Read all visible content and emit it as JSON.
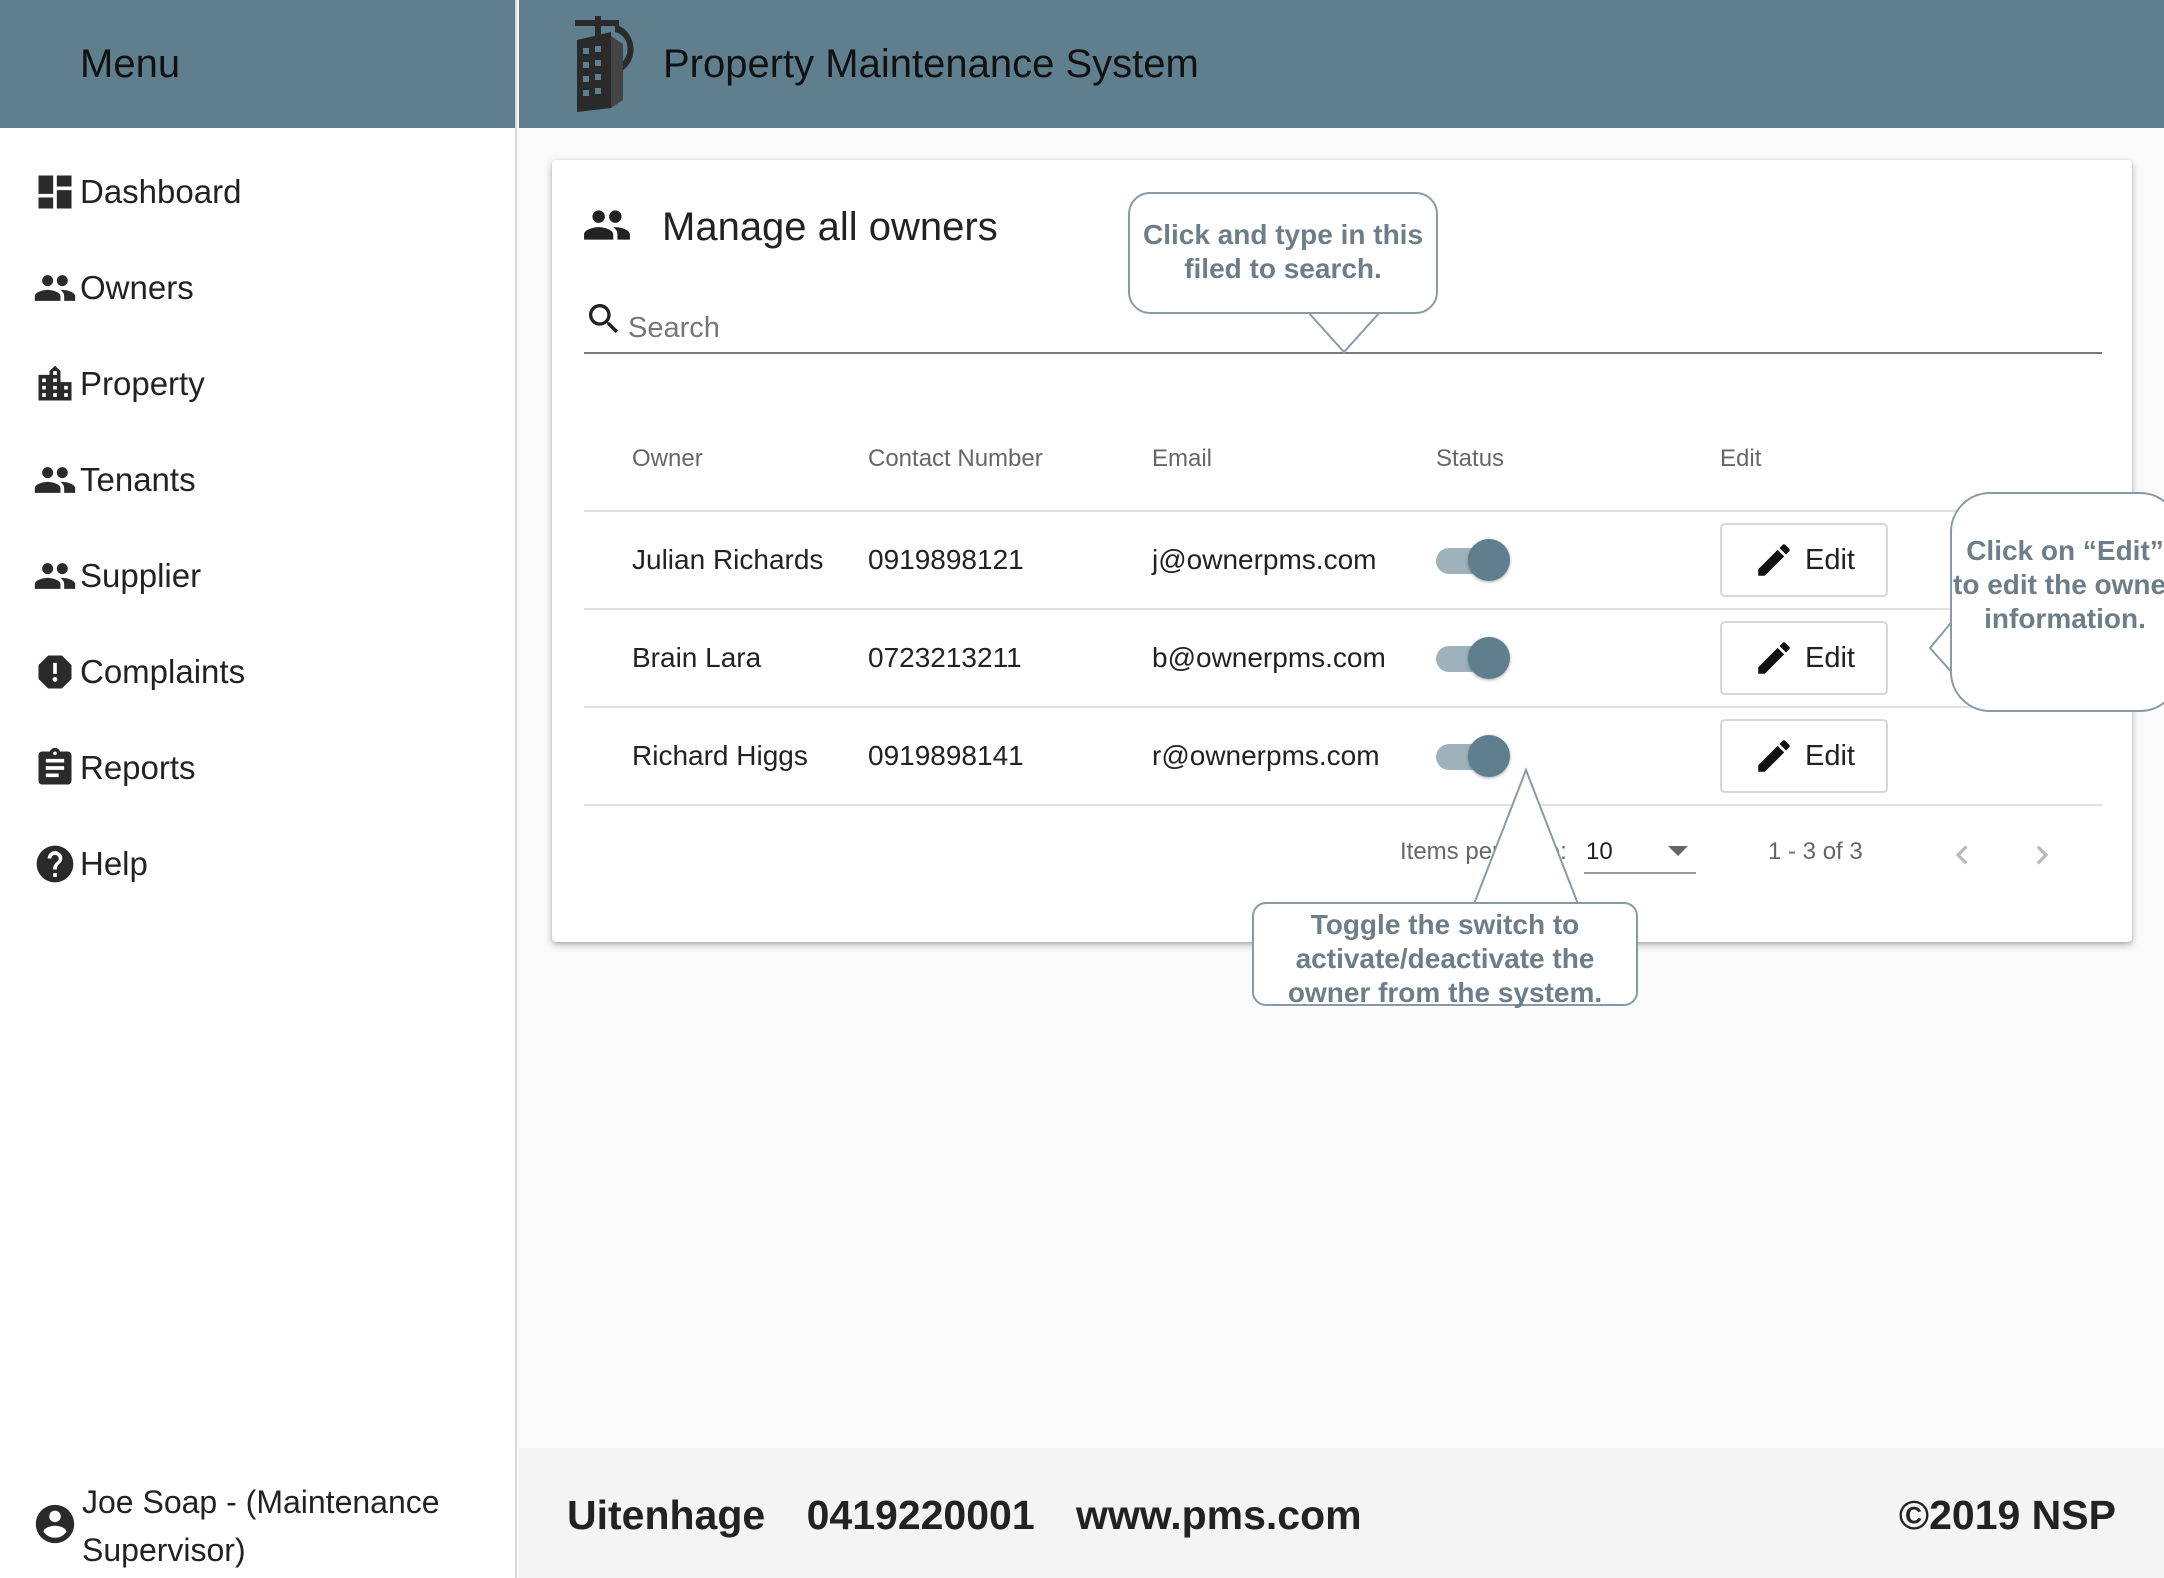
{
  "sidebar": {
    "title": "Menu",
    "items": [
      {
        "label": "Dashboard",
        "icon": "dashboard-icon"
      },
      {
        "label": "Owners",
        "icon": "people-icon"
      },
      {
        "label": "Property",
        "icon": "building-icon"
      },
      {
        "label": "Tenants",
        "icon": "people-icon"
      },
      {
        "label": "Supplier",
        "icon": "people-icon"
      },
      {
        "label": "Complaints",
        "icon": "alert-octagon-icon"
      },
      {
        "label": "Reports",
        "icon": "clipboard-icon"
      },
      {
        "label": "Help",
        "icon": "help-circle-icon"
      }
    ],
    "user": "Joe Soap - (Maintenance Supervisor)"
  },
  "header": {
    "app_title": "Property Maintenance System",
    "logo": "building-crane-logo",
    "bg_color": "#5f7f8f"
  },
  "main": {
    "title": "Manage all owners",
    "title_icon": "people-icon",
    "search": {
      "placeholder": "Search",
      "value": ""
    },
    "table": {
      "columns": [
        "Owner",
        "Contact Number",
        "Email",
        "Status",
        "Edit"
      ],
      "rows": [
        {
          "owner": "Julian Richards",
          "contact": "0919898121",
          "email": "j@ownerpms.com",
          "status": "active",
          "edit_label": "Edit"
        },
        {
          "owner": "Brain Lara",
          "contact": "0723213211",
          "email": "b@ownerpms.com",
          "status": "active",
          "edit_label": "Edit"
        },
        {
          "owner": "Richard Higgs",
          "contact": "0919898141",
          "email": "r@ownerpms.com",
          "status": "active",
          "edit_label": "Edit"
        }
      ]
    },
    "paginator": {
      "items_per_page_label": "Items per page:",
      "items_per_page_value": "10",
      "range": "1 - 3 of 3"
    }
  },
  "callouts": {
    "search": "Click and type in this filed to search.",
    "edit": "Click on “Edit” to edit the owner information.",
    "toggle": "Toggle the switch to activate/deactivate the owner from the system."
  },
  "footer": {
    "city": "Uitenhage",
    "phone": "0419220001",
    "website": "www.pms.com",
    "copyright": "©2019 NSP"
  },
  "colors": {
    "accent": "#5f7f8f",
    "callout_text": "#6d7e89"
  }
}
